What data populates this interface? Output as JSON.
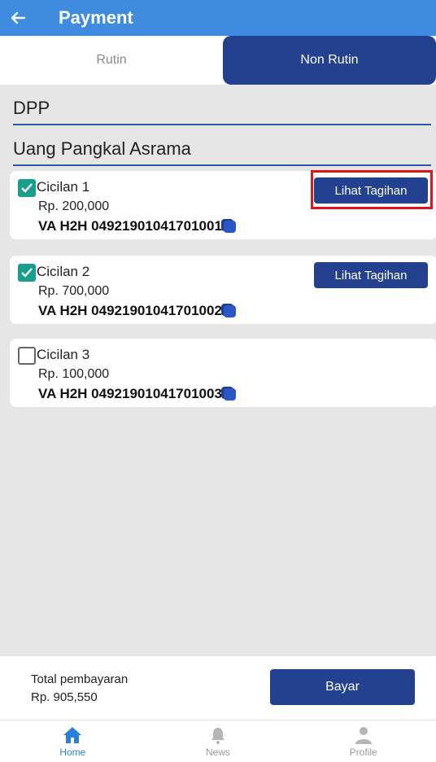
{
  "header": {
    "title": "Payment"
  },
  "tabs": [
    {
      "label": "Rutin",
      "active": false
    },
    {
      "label": "Non Rutin",
      "active": true
    }
  ],
  "sections": {
    "dpp": "DPP",
    "asrama": "Uang Pangkal Asrama"
  },
  "items": [
    {
      "title": "Cicilan 1",
      "amount": "Rp. 200,000",
      "va": "VA H2H 04921901041701001",
      "checked": true,
      "button_label": "Lihat Tagihan"
    },
    {
      "title": "Cicilan 2",
      "amount": "Rp. 700,000",
      "va": "VA H2H 04921901041701002",
      "checked": true,
      "button_label": "Lihat Tagihan"
    },
    {
      "title": "Cicilan 3",
      "amount": "Rp. 100,000",
      "va": "VA H2H 04921901041701003",
      "checked": false
    }
  ],
  "footer": {
    "total_label": "Total pembayaran",
    "total_value": "Rp. 905,550",
    "pay_button": "Bayar"
  },
  "nav": [
    {
      "label": "Home",
      "icon": "home-icon",
      "active": true
    },
    {
      "label": "News",
      "icon": "bell-icon",
      "active": false
    },
    {
      "label": "Profile",
      "icon": "person-icon",
      "active": false
    }
  ],
  "colors": {
    "appbar": "#3f8be0",
    "primary": "#23418f",
    "checkbox": "#1a9e8c",
    "highlight": "#e0141b",
    "nav_active": "#2a80d8"
  }
}
